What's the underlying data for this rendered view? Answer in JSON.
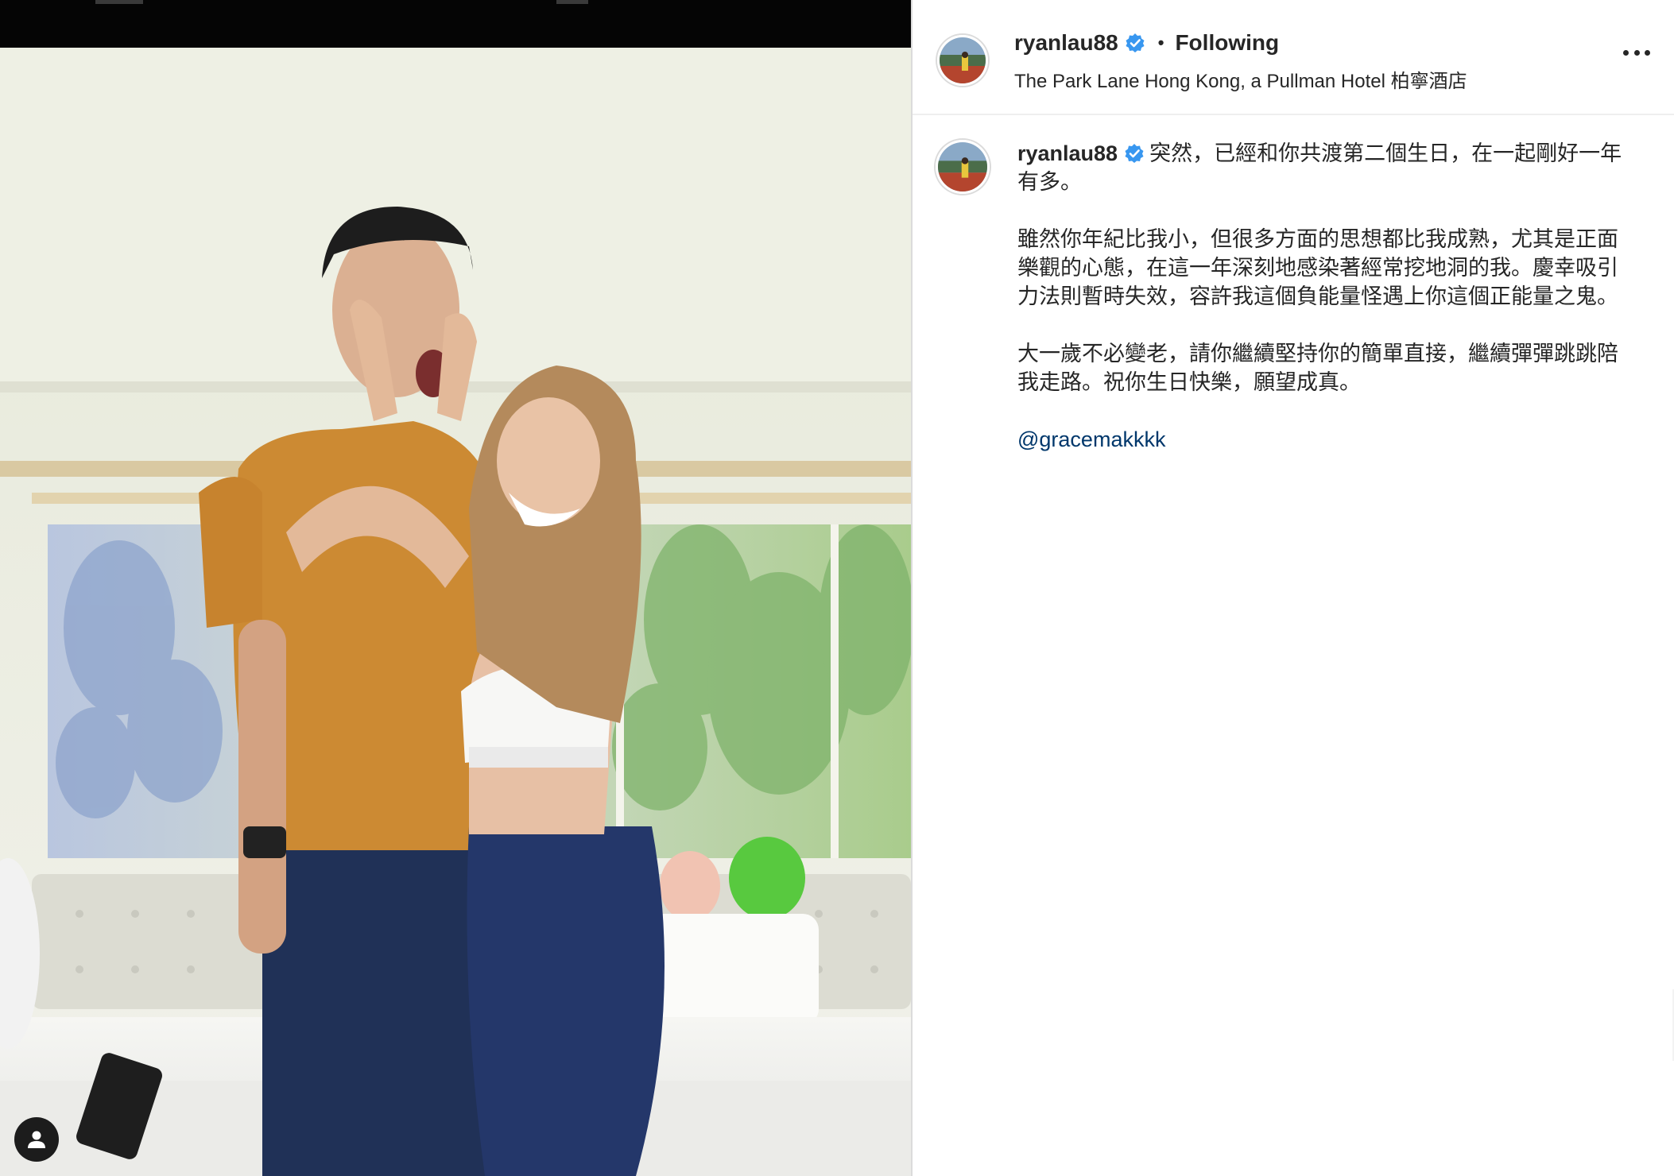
{
  "post": {
    "username": "ryanlau88",
    "follow_status": "Following",
    "separator": "•",
    "location": "The Park Lane Hong Kong, a Pullman Hotel 柏寧酒店"
  },
  "caption": {
    "username": "ryanlau88",
    "line1": "突然，已經和你共渡第二個生日，在一起剛好一年有多。",
    "para2": "雖然你年紀比我小，但很多方面的思想都比我成熟，尤其是正面樂觀的心態，在這一年深刻地感染著經常挖地洞的我。慶幸吸引力法則暫時失效，容許我這個負能量怪遇上你這個正能量之鬼。",
    "para3": "大一歲不必變老，請你繼續堅持你的簡單直接，繼續彈彈跳跳陪我走路。祝你生日快樂，願望成真。",
    "mention": "@gracemakkkk"
  },
  "icons": {
    "verified": "verified-badge-icon",
    "more": "more-options-icon",
    "user_tag": "user-tag-icon"
  },
  "colors": {
    "verified_blue": "#3897f0",
    "mention_blue": "#00376b",
    "text": "#262626",
    "divider": "#dbdbdb"
  }
}
